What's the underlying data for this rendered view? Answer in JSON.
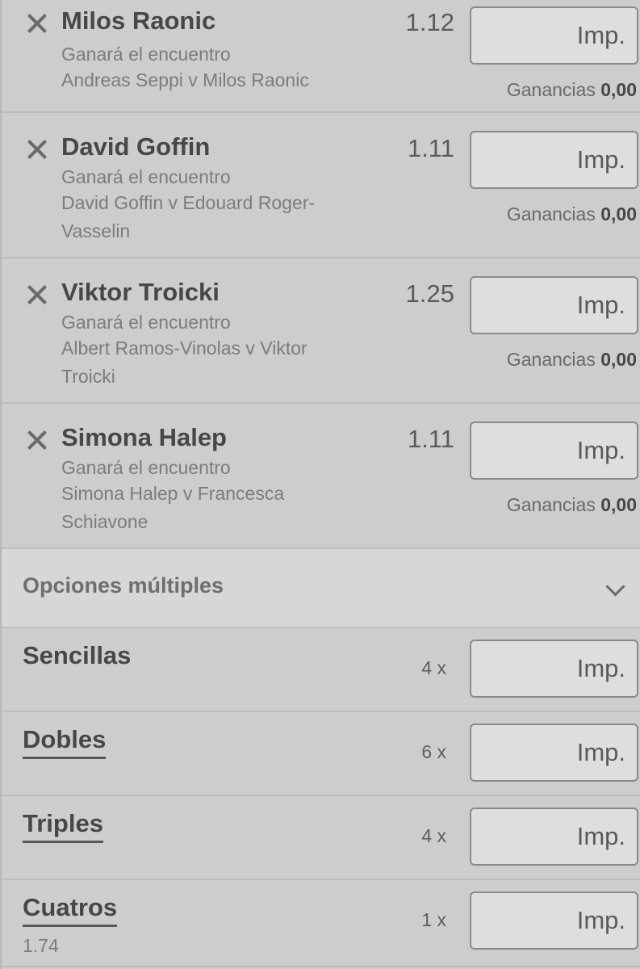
{
  "stake_placeholder": "Imp.",
  "winnings_label": "Ganancias",
  "selections": [
    {
      "name": "Milos Raonic",
      "market": "Ganará el encuentro",
      "event": "Andreas Seppi v Milos Raonic",
      "odds": "1.12",
      "winnings": "0,00"
    },
    {
      "name": "David Goffin",
      "market": "Ganará el encuentro",
      "event": "David Goffin v Edouard Roger-Vasselin",
      "odds": "1.11",
      "winnings": "0,00"
    },
    {
      "name": "Viktor Troicki",
      "market": "Ganará el encuentro",
      "event": "Albert Ramos-Vinolas v Viktor Troicki",
      "odds": "1.25",
      "winnings": "0,00"
    },
    {
      "name": "Simona Halep",
      "market": "Ganará el encuentro",
      "event": "Simona Halep v Francesca Schiavone",
      "odds": "1.11",
      "winnings": "0,00"
    }
  ],
  "multiple_options": {
    "title": "Opciones múltiples"
  },
  "combos": [
    {
      "name": "Sencillas",
      "count": "4 x"
    },
    {
      "name": "Dobles",
      "count": "6 x"
    },
    {
      "name": "Triples",
      "count": "4 x"
    },
    {
      "name": "Cuatros",
      "count": "1 x",
      "odds": "1.74"
    }
  ],
  "colors": {
    "background": "#cdcdcd",
    "input_background": "#dedede",
    "text_primary": "#474747",
    "text_secondary": "#7c7c7c"
  }
}
